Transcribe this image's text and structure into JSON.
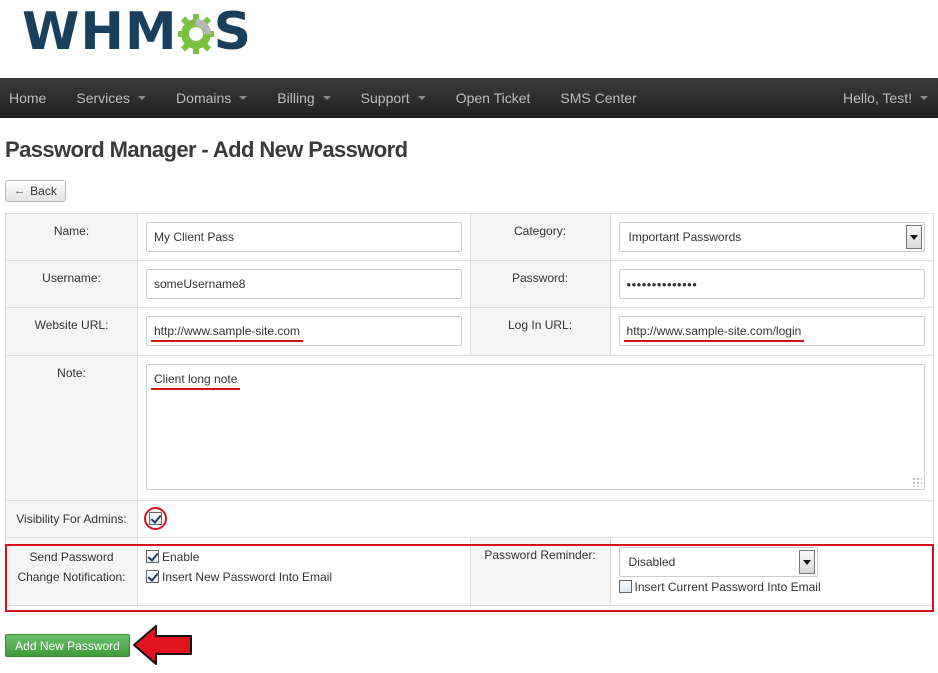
{
  "brand": {
    "logo_text_left": "WHM",
    "logo_text_right": "S",
    "logo_colors": {
      "text": "#1a3f5c",
      "gear": "#7cc242"
    }
  },
  "nav": {
    "items": [
      {
        "label": "Home",
        "dropdown": false
      },
      {
        "label": "Services",
        "dropdown": true
      },
      {
        "label": "Domains",
        "dropdown": true
      },
      {
        "label": "Billing",
        "dropdown": true
      },
      {
        "label": "Support",
        "dropdown": true
      },
      {
        "label": "Open Ticket",
        "dropdown": false
      },
      {
        "label": "SMS Center",
        "dropdown": false
      }
    ],
    "user_greeting": "Hello, Test!"
  },
  "page": {
    "title": "Password Manager - Add New Password",
    "back_label": "Back"
  },
  "form": {
    "name_label": "Name:",
    "name_value": "My Client Pass",
    "category_label": "Category:",
    "category_value": "Important Passwords",
    "username_label": "Username:",
    "username_value": "someUsername8",
    "password_label": "Password:",
    "password_value": "••••••••••••••",
    "website_label": "Website URL:",
    "website_value": "http://www.sample-site.com",
    "login_label": "Log In URL:",
    "login_value": "http://www.sample-site.com/login",
    "note_label": "Note:",
    "note_value": "Client long note",
    "visibility_label": "Visibility For Admins:",
    "visibility_checked": true,
    "notify_label_line1": "Send Password",
    "notify_label_line2": "Change Notification:",
    "enable_label": "Enable",
    "enable_checked": true,
    "insert_new_label": "Insert New Password Into Email",
    "insert_new_checked": true,
    "reminder_label": "Password Reminder:",
    "reminder_value": "Disabled",
    "insert_current_label": "Insert Current Password Into Email",
    "insert_current_checked": false,
    "submit_label": "Add New Password"
  },
  "colors": {
    "navbar": "#2b2b2b",
    "annotation_red": "#d8121c",
    "submit_green": "#4fa94c"
  }
}
